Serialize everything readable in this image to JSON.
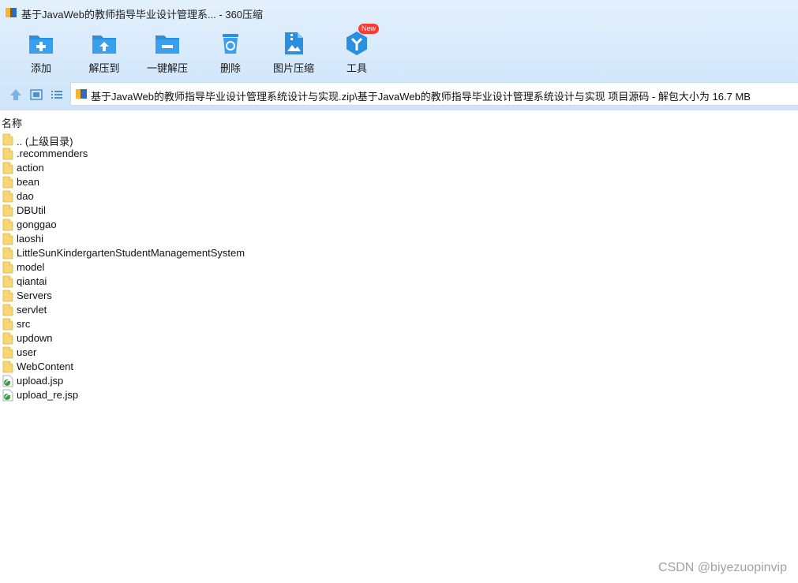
{
  "window": {
    "title": "基于JavaWeb的教师指导毕业设计管理系... - 360压缩"
  },
  "toolbar": {
    "add": "添加",
    "extract_to": "解压到",
    "one_click_extract": "一键解压",
    "delete": "删除",
    "image_compress": "图片压缩",
    "tools": "工具",
    "new_badge": "New"
  },
  "nav": {
    "path": "基于JavaWeb的教师指导毕业设计管理系统设计与实现.zip\\基于JavaWeb的教师指导毕业设计管理系统设计与实现 项目源码 - 解包大小为 16.7 MB"
  },
  "list": {
    "column_name": "名称",
    "items": [
      {
        "name": ".. (上级目录)",
        "kind": "folder"
      },
      {
        "name": ".recommenders",
        "kind": "folder"
      },
      {
        "name": "action",
        "kind": "folder"
      },
      {
        "name": "bean",
        "kind": "folder"
      },
      {
        "name": "dao",
        "kind": "folder"
      },
      {
        "name": "DBUtil",
        "kind": "folder"
      },
      {
        "name": "gonggao",
        "kind": "folder"
      },
      {
        "name": "laoshi",
        "kind": "folder"
      },
      {
        "name": "LittleSunKindergartenStudentManagementSystem",
        "kind": "folder"
      },
      {
        "name": "model",
        "kind": "folder"
      },
      {
        "name": "qiantai",
        "kind": "folder"
      },
      {
        "name": "Servers",
        "kind": "folder"
      },
      {
        "name": "servlet",
        "kind": "folder"
      },
      {
        "name": "src",
        "kind": "folder"
      },
      {
        "name": "updown",
        "kind": "folder"
      },
      {
        "name": "user",
        "kind": "folder"
      },
      {
        "name": "WebContent",
        "kind": "folder"
      },
      {
        "name": "upload.jsp",
        "kind": "jsp"
      },
      {
        "name": "upload_re.jsp",
        "kind": "jsp"
      }
    ]
  },
  "watermark": "CSDN @biyezuopinvip",
  "colors": {
    "toolbar_bg": "#d6e9fb",
    "icon_blue": "#2a8fe0",
    "folder_yellow": "#f7d774",
    "badge_red": "#ff3b30"
  }
}
